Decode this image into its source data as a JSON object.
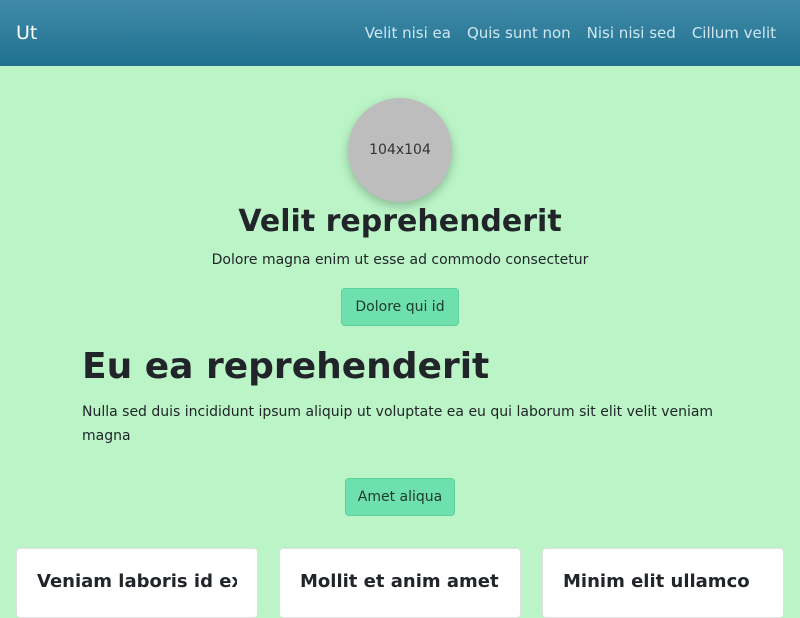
{
  "navbar": {
    "brand": "Ut",
    "links": [
      "Velit nisi ea",
      "Quis sunt non",
      "Nisi nisi sed",
      "Cillum velit"
    ]
  },
  "hero": {
    "avatar_text": "104x104",
    "title": "Velit reprehenderit",
    "subtitle": "Dolore magna enim ut esse ad commodo consectetur",
    "button_label": "Dolore qui id"
  },
  "section": {
    "title": "Eu ea reprehenderit",
    "text": "Nulla sed duis incididunt ipsum aliquip ut voluptate ea eu qui laborum sit elit velit veniam magna",
    "button_label": "Amet aliqua"
  },
  "cards": [
    {
      "title": "Veniam laboris id ex"
    },
    {
      "title": "Mollit et anim amet"
    },
    {
      "title": "Minim elit ullamco"
    }
  ],
  "colors": {
    "background": "#bbf5c7",
    "navbar": "#2a7d9b",
    "button": "#6ee0ad"
  }
}
